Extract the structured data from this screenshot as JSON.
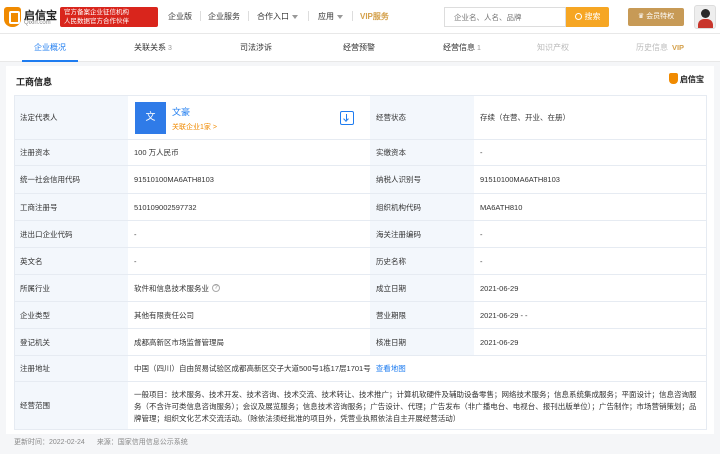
{
  "header": {
    "logo_text": "启信宝",
    "logo_domain": "Qixin.com",
    "badge_line1": "官方备案企业征信机构",
    "badge_line2": "人民数据官方合作伙伴",
    "nav": [
      "企业版",
      "企业服务",
      "合作入口",
      "应用"
    ],
    "vip_label": "VIP服务",
    "search_placeholder": "企业名、人名、品牌",
    "search_button": "搜索",
    "member_button": "会员特权"
  },
  "tabs": [
    {
      "label": "企业概况",
      "count": ""
    },
    {
      "label": "关联关系",
      "count": "3"
    },
    {
      "label": "司法涉诉",
      "count": ""
    },
    {
      "label": "经营预警",
      "count": ""
    },
    {
      "label": "经营信息",
      "count": "1"
    },
    {
      "label": "知识产权",
      "count": ""
    },
    {
      "label": "历史信息",
      "count": "",
      "vip": "VIP"
    }
  ],
  "section": {
    "title": "工商信息",
    "brand": "启信宝"
  },
  "legal_rep": {
    "label": "法定代表人",
    "avatar_char": "文",
    "name": "文豪",
    "link": "关联企业1家 >"
  },
  "rows": [
    {
      "l1": "经营状态",
      "v1": "存续（在营、开业、在册）"
    },
    {
      "l1": "注册资本",
      "v1": "100 万人民币",
      "l2": "实缴资本",
      "v2": "-"
    },
    {
      "l1": "统一社会信用代码",
      "v1": "91510100MA6ATH8103",
      "l2": "纳税人识别号",
      "v2": "91510100MA6ATH8103"
    },
    {
      "l1": "工商注册号",
      "v1": "510109002597732",
      "l2": "组织机构代码",
      "v2": "MA6ATH810"
    },
    {
      "l1": "进出口企业代码",
      "v1": "-",
      "l2": "海关注册编码",
      "v2": "-"
    },
    {
      "l1": "英文名",
      "v1": "-",
      "l2": "历史名称",
      "v2": "-"
    },
    {
      "l1": "所属行业",
      "v1": "软件和信息技术服务业",
      "l2": "成立日期",
      "v2": "2021-06-29"
    },
    {
      "l1": "企业类型",
      "v1": "其他有限责任公司",
      "l2": "营业期限",
      "v2": "2021-06-29 - -"
    },
    {
      "l1": "登记机关",
      "v1": "成都高新区市场监督管理局",
      "l2": "核准日期",
      "v2": "2021-06-29"
    }
  ],
  "address": {
    "label": "注册地址",
    "value": "中国（四川）自由贸易试验区成都高新区交子大道500号1栋17层1701号",
    "map_link": "查看地图"
  },
  "scope": {
    "label": "经营范围",
    "value": "一般项目：技术服务、技术开发、技术咨询、技术交流、技术转让、技术推广；计算机软硬件及辅助设备零售；网络技术服务；信息系统集成服务；平面设计；信息咨询服务（不含许可类信息咨询服务）；会议及展览服务；信息技术咨询服务；广告设计、代理；广告发布（非广播电台、电视台、报刊出版单位）；广告制作；市场营销策划；品牌管理；组织文化艺术交流活动。（除依法须经批准的项目外，凭营业执照依法自主开展经营活动）"
  },
  "footer": {
    "updated": "更新时间：2022-02-24",
    "source": "来源：国家信用信息公示系统"
  }
}
